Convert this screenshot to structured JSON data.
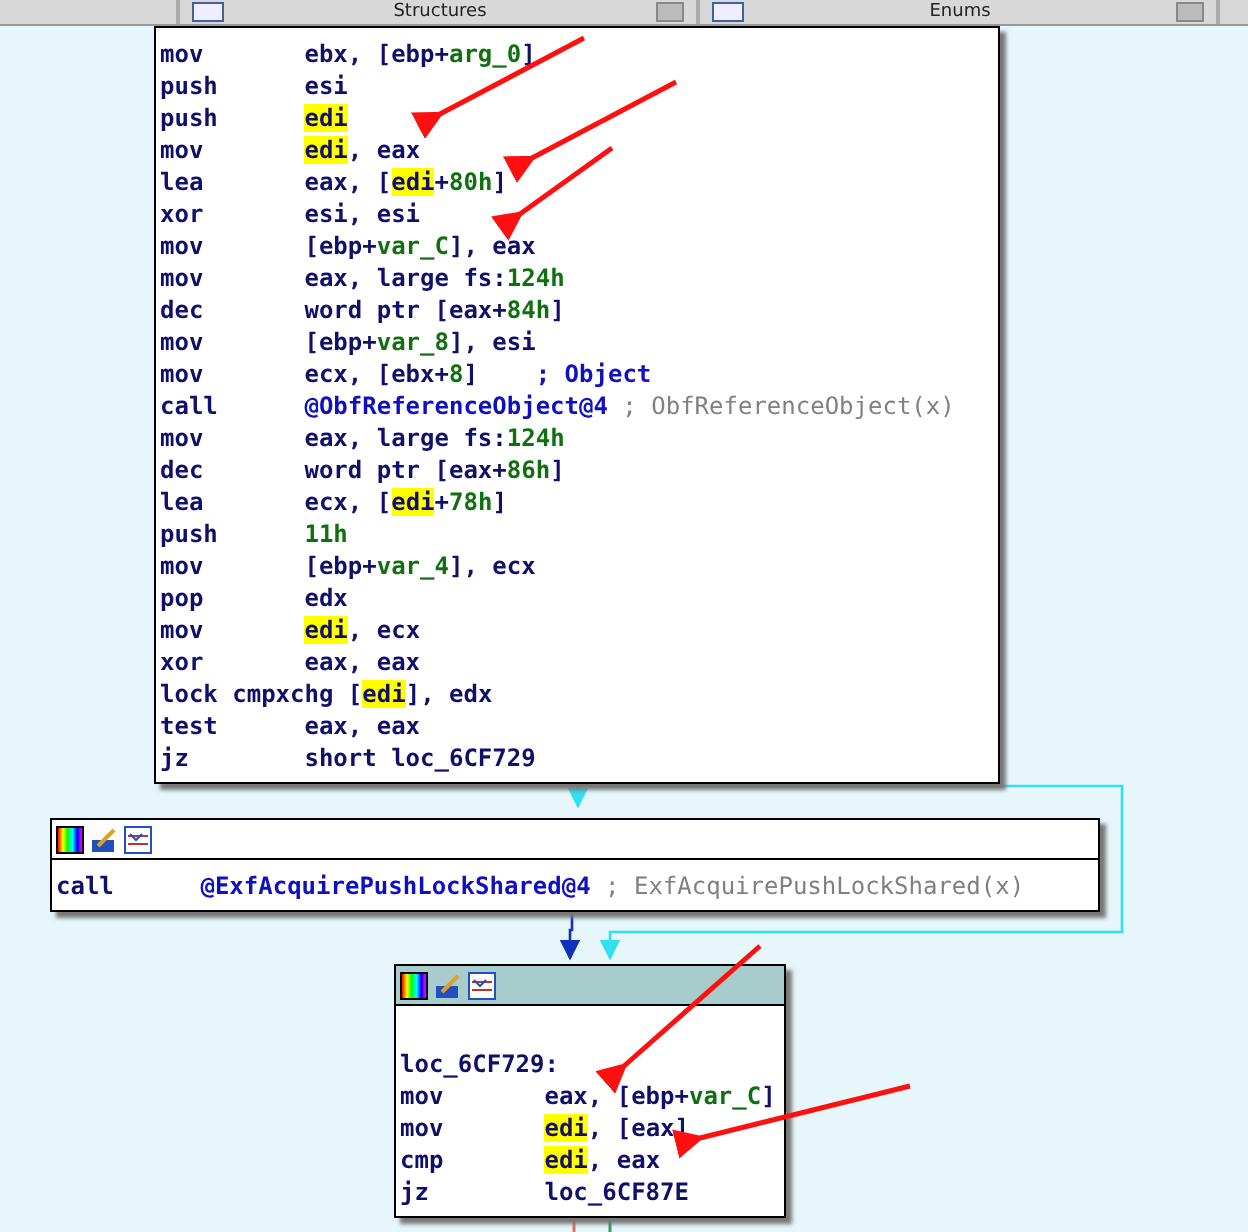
{
  "tabs": [
    {
      "label": "Structures",
      "selected": false
    },
    {
      "label": "Enums",
      "selected": false
    }
  ],
  "blocks": [
    {
      "kind": "main",
      "lines": [
        {
          "mnemonic": "mov",
          "ops": [
            {
              "text": "ebx, [ebp+",
              "kind": "plain"
            },
            {
              "text": "arg_0",
              "kind": "num"
            },
            {
              "text": "]",
              "kind": "plain"
            }
          ]
        },
        {
          "mnemonic": "push",
          "ops": [
            {
              "text": "esi",
              "kind": "plain"
            }
          ]
        },
        {
          "mnemonic": "push",
          "ops": [
            {
              "text": "edi",
              "kind": "reg"
            }
          ]
        },
        {
          "mnemonic": "mov",
          "ops": [
            {
              "text": "edi",
              "kind": "reg"
            },
            {
              "text": ", eax",
              "kind": "plain"
            }
          ]
        },
        {
          "mnemonic": "lea",
          "ops": [
            {
              "text": "eax, [",
              "kind": "plain"
            },
            {
              "text": "edi",
              "kind": "reg"
            },
            {
              "text": "+",
              "kind": "plain"
            },
            {
              "text": "80h",
              "kind": "num"
            },
            {
              "text": "]",
              "kind": "plain"
            }
          ]
        },
        {
          "mnemonic": "xor",
          "ops": [
            {
              "text": "esi, esi",
              "kind": "plain"
            }
          ]
        },
        {
          "mnemonic": "mov",
          "ops": [
            {
              "text": "[ebp+",
              "kind": "plain"
            },
            {
              "text": "var_C",
              "kind": "num"
            },
            {
              "text": "], eax",
              "kind": "plain"
            }
          ]
        },
        {
          "mnemonic": "mov",
          "ops": [
            {
              "text": "eax, large fs:",
              "kind": "plain"
            },
            {
              "text": "124h",
              "kind": "num"
            }
          ]
        },
        {
          "mnemonic": "dec",
          "ops": [
            {
              "text": "word ptr [eax+",
              "kind": "plain"
            },
            {
              "text": "84h",
              "kind": "num"
            },
            {
              "text": "]",
              "kind": "plain"
            }
          ]
        },
        {
          "mnemonic": "mov",
          "ops": [
            {
              "text": "[ebp+",
              "kind": "plain"
            },
            {
              "text": "var_8",
              "kind": "num"
            },
            {
              "text": "], esi",
              "kind": "plain"
            }
          ]
        },
        {
          "mnemonic": "mov",
          "ops": [
            {
              "text": "ecx, [ebx+",
              "kind": "plain"
            },
            {
              "text": "8",
              "kind": "num"
            },
            {
              "text": "]    ",
              "kind": "plain"
            },
            {
              "text": "; Object",
              "kind": "comment"
            }
          ]
        },
        {
          "mnemonic": "call",
          "ops": [
            {
              "text": "@ObfReferenceObject@4",
              "kind": "func"
            },
            {
              "text": " ; ObfReferenceObject(x)",
              "kind": "ref"
            }
          ]
        },
        {
          "mnemonic": "mov",
          "ops": [
            {
              "text": "eax, large fs:",
              "kind": "plain"
            },
            {
              "text": "124h",
              "kind": "num"
            }
          ]
        },
        {
          "mnemonic": "dec",
          "ops": [
            {
              "text": "word ptr [eax+",
              "kind": "plain"
            },
            {
              "text": "86h",
              "kind": "num"
            },
            {
              "text": "]",
              "kind": "plain"
            }
          ]
        },
        {
          "mnemonic": "lea",
          "ops": [
            {
              "text": "ecx, [",
              "kind": "plain"
            },
            {
              "text": "edi",
              "kind": "reg"
            },
            {
              "text": "+",
              "kind": "plain"
            },
            {
              "text": "78h",
              "kind": "num"
            },
            {
              "text": "]",
              "kind": "plain"
            }
          ]
        },
        {
          "mnemonic": "push",
          "ops": [
            {
              "text": "11h",
              "kind": "num"
            }
          ]
        },
        {
          "mnemonic": "mov",
          "ops": [
            {
              "text": "[ebp+",
              "kind": "plain"
            },
            {
              "text": "var_4",
              "kind": "num"
            },
            {
              "text": "], ecx",
              "kind": "plain"
            }
          ]
        },
        {
          "mnemonic": "pop",
          "ops": [
            {
              "text": "edx",
              "kind": "plain"
            }
          ]
        },
        {
          "mnemonic": "mov",
          "ops": [
            {
              "text": "edi",
              "kind": "reg"
            },
            {
              "text": ", ecx",
              "kind": "plain"
            }
          ]
        },
        {
          "mnemonic": "xor",
          "ops": [
            {
              "text": "eax, eax",
              "kind": "plain"
            }
          ]
        },
        {
          "mnemonic": "lock cmpxchg",
          "ops": [
            {
              "text": "[",
              "kind": "plain"
            },
            {
              "text": "edi",
              "kind": "reg"
            },
            {
              "text": "], edx",
              "kind": "plain"
            }
          ]
        },
        {
          "mnemonic": "test",
          "ops": [
            {
              "text": "eax, eax",
              "kind": "plain"
            }
          ]
        },
        {
          "mnemonic": "jz",
          "ops": [
            {
              "text": "short loc_6CF729",
              "kind": "plain"
            }
          ]
        }
      ]
    },
    {
      "kind": "call",
      "lines": [
        {
          "mnemonic": "call",
          "ops": [
            {
              "text": "@ExfAcquirePushLockShared@4",
              "kind": "func"
            },
            {
              "text": " ; ExfAcquirePushLockShared(x)",
              "kind": "ref"
            }
          ]
        }
      ]
    },
    {
      "kind": "target",
      "label": "loc_6CF729:",
      "lines": [
        {
          "mnemonic": "mov",
          "ops": [
            {
              "text": "eax, [ebp+",
              "kind": "plain"
            },
            {
              "text": "var_C",
              "kind": "num"
            },
            {
              "text": "]",
              "kind": "plain"
            }
          ]
        },
        {
          "mnemonic": "mov",
          "ops": [
            {
              "text": "edi",
              "kind": "reg"
            },
            {
              "text": ", [eax]",
              "kind": "plain"
            }
          ]
        },
        {
          "mnemonic": "cmp",
          "ops": [
            {
              "text": "edi",
              "kind": "reg"
            },
            {
              "text": ", eax",
              "kind": "plain"
            }
          ]
        },
        {
          "mnemonic": "jz",
          "ops": [
            {
              "text": "loc_6CF87E",
              "kind": "plain"
            }
          ]
        }
      ]
    }
  ]
}
